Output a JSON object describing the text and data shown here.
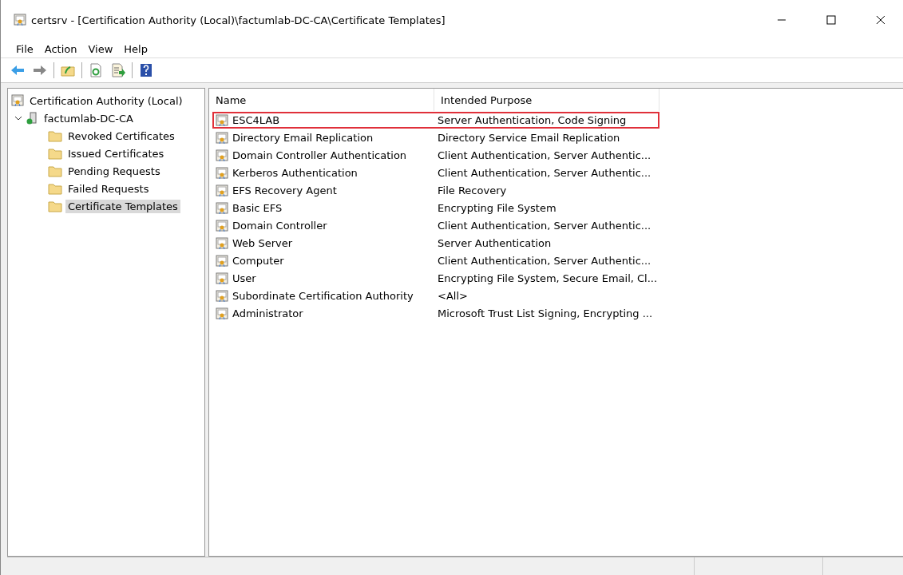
{
  "window": {
    "title": "certsrv - [Certification Authority (Local)\\factumlab-DC-CA\\Certificate Templates]"
  },
  "menu": [
    "File",
    "Action",
    "View",
    "Help"
  ],
  "tree": {
    "label": "Certification Authority (Local)",
    "children": [
      {
        "label": "factumlab-DC-CA",
        "expanded": true,
        "selected": false,
        "children": [
          {
            "label": "Revoked Certificates",
            "selected": false
          },
          {
            "label": "Issued Certificates",
            "selected": false
          },
          {
            "label": "Pending Requests",
            "selected": false
          },
          {
            "label": "Failed Requests",
            "selected": false
          },
          {
            "label": "Certificate Templates",
            "selected": true
          }
        ]
      }
    ]
  },
  "table": {
    "columns": [
      "Name",
      "Intended Purpose"
    ],
    "rows": [
      {
        "name": "ESC4LAB",
        "purpose": "Server Authentication, Code Signing",
        "highlighted": true
      },
      {
        "name": "Directory Email Replication",
        "purpose": "Directory Service Email Replication",
        "highlighted": false
      },
      {
        "name": "Domain Controller Authentication",
        "purpose": "Client Authentication, Server Authentic...",
        "highlighted": false
      },
      {
        "name": "Kerberos Authentication",
        "purpose": "Client Authentication, Server Authentic...",
        "highlighted": false
      },
      {
        "name": "EFS Recovery Agent",
        "purpose": "File Recovery",
        "highlighted": false
      },
      {
        "name": "Basic EFS",
        "purpose": "Encrypting File System",
        "highlighted": false
      },
      {
        "name": "Domain Controller",
        "purpose": "Client Authentication, Server Authentic...",
        "highlighted": false
      },
      {
        "name": "Web Server",
        "purpose": "Server Authentication",
        "highlighted": false
      },
      {
        "name": "Computer",
        "purpose": "Client Authentication, Server Authentic...",
        "highlighted": false
      },
      {
        "name": "User",
        "purpose": "Encrypting File System, Secure Email, Cl...",
        "highlighted": false
      },
      {
        "name": "Subordinate Certification Authority",
        "purpose": "<All>",
        "highlighted": false
      },
      {
        "name": "Administrator",
        "purpose": "Microsoft Trust List Signing, Encrypting ...",
        "highlighted": false
      }
    ]
  }
}
